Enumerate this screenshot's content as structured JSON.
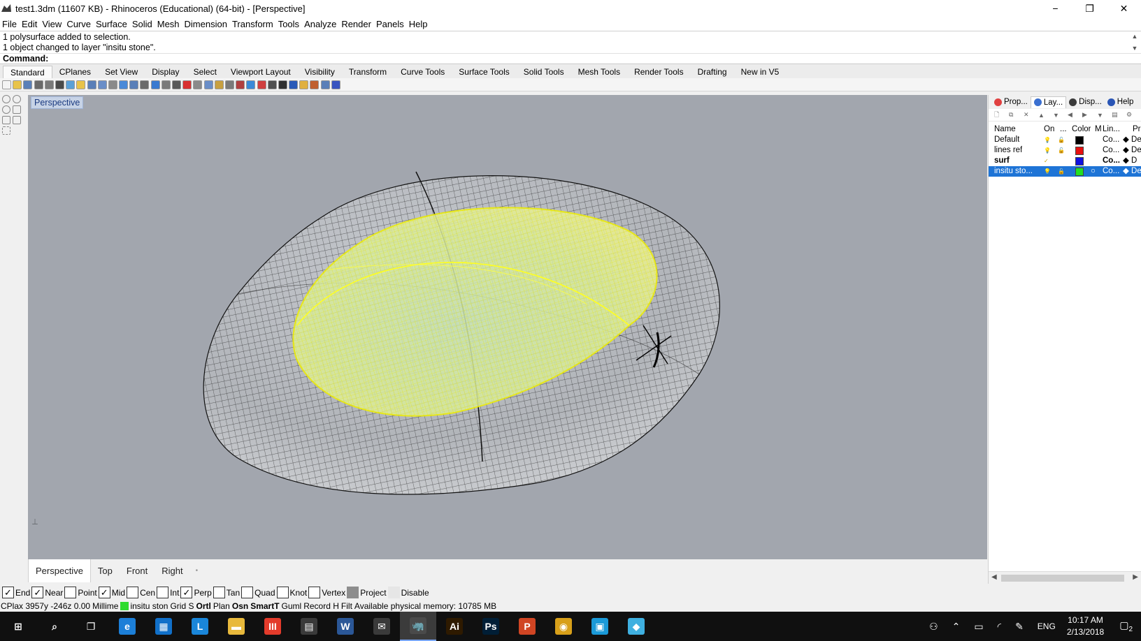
{
  "window": {
    "title": "test1.3dm (11607 KB) - Rhinoceros (Educational) (64-bit) - [Perspective]",
    "minimize": "−",
    "restore": "❐",
    "close": "✕"
  },
  "menu": [
    "File",
    "Edit",
    "View",
    "Curve",
    "Surface",
    "Solid",
    "Mesh",
    "Dimension",
    "Transform",
    "Tools",
    "Analyze",
    "Render",
    "Panels",
    "Help"
  ],
  "command": {
    "history": [
      "1 polysurface added to selection.",
      "1 object changed to layer \"insitu stone\"."
    ],
    "prompt": "Command:"
  },
  "toolbar_tabs": [
    "Standard",
    "CPlanes",
    "Set View",
    "Display",
    "Select",
    "Viewport Layout",
    "Visibility",
    "Transform",
    "Curve Tools",
    "Surface Tools",
    "Solid Tools",
    "Mesh Tools",
    "Render Tools",
    "Drafting",
    "New in V5"
  ],
  "toolbar_tabs_active": "Standard",
  "viewport": {
    "label": "Perspective",
    "tabs": [
      "Perspective",
      "Top",
      "Front",
      "Right"
    ],
    "active_tab": "Perspective",
    "background": "#a2a6ae"
  },
  "panel": {
    "tabs": [
      {
        "label": "Prop...",
        "icon": "properties-icon",
        "color": "#e04040"
      },
      {
        "label": "Lay...",
        "icon": "layers-icon",
        "color": "#3a6fd0"
      },
      {
        "label": "Disp...",
        "icon": "display-icon",
        "color": "#3a3a3a"
      },
      {
        "label": "Help",
        "icon": "help-icon",
        "color": "#2a55b5"
      }
    ],
    "active_tab": "Lay...",
    "columns": {
      "name": "Name",
      "on": "On",
      "lock": "...",
      "color": "Color",
      "material": "M",
      "linetype": "Lin...",
      "print": "Pr"
    },
    "layers": [
      {
        "name": "Default",
        "on": "💡",
        "lock": "🔓",
        "color": "#000000",
        "material": "",
        "linetype": "Co...",
        "print": "◆ De",
        "selected": false,
        "current": false
      },
      {
        "name": "lines ref",
        "on": "💡",
        "lock": "🔓",
        "color": "#e81010",
        "material": "",
        "linetype": "Co...",
        "print": "◆ De",
        "selected": false,
        "current": false
      },
      {
        "name": "surf",
        "on": "✓",
        "lock": "",
        "color": "#1010e0",
        "material": "",
        "linetype": "Co...",
        "print": "◆ D",
        "selected": false,
        "current": true
      },
      {
        "name": "insitu sto...",
        "on": "💡",
        "lock": "🔓",
        "color": "#21e021",
        "material": "○",
        "linetype": "Co...",
        "print": "◆ De",
        "selected": true,
        "current": false
      }
    ]
  },
  "osnaps": [
    {
      "label": "End",
      "checked": true
    },
    {
      "label": "Near",
      "checked": true
    },
    {
      "label": "Point",
      "checked": false
    },
    {
      "label": "Mid",
      "checked": true
    },
    {
      "label": "Cen",
      "checked": false
    },
    {
      "label": "Int",
      "checked": false
    },
    {
      "label": "Perp",
      "checked": true
    },
    {
      "label": "Tan",
      "checked": false
    },
    {
      "label": "Quad",
      "checked": false
    },
    {
      "label": "Knot",
      "checked": false
    },
    {
      "label": "Vertex",
      "checked": false
    },
    {
      "label": "Project",
      "checked": false,
      "style": "gray"
    },
    {
      "label": "Disable",
      "checked": false,
      "style": "light"
    }
  ],
  "status": {
    "cplane": "CPlax 3957y -246z 0.00",
    "units": "Millime",
    "layer": "insitu ston",
    "layer_color": "#2edb2e",
    "grid": "Grid S",
    "ortho": "Ortl",
    "planar": "Plan",
    "osnap": "Osn",
    "smarttrack": "SmartT",
    "gumball": "Guml",
    "record": "Record H",
    "filter": "Filt",
    "memory": "Available physical memory: 10785 MB"
  },
  "taskbar": {
    "apps": [
      {
        "name": "start-icon",
        "glyph": "⊞",
        "color": "#101010"
      },
      {
        "name": "search-icon",
        "glyph": "⌕",
        "color": "#101010"
      },
      {
        "name": "task-view-icon",
        "glyph": "❐",
        "color": "#101010"
      },
      {
        "name": "edge-icon",
        "glyph": "e",
        "color": "#1c7fd8"
      },
      {
        "name": "store-icon",
        "glyph": "▦",
        "color": "#1170c9"
      },
      {
        "name": "lumion-icon",
        "glyph": "L",
        "color": "#1a86d9"
      },
      {
        "name": "file-explorer-icon",
        "glyph": "▬",
        "color": "#e8b93c"
      },
      {
        "name": "app-red-icon",
        "glyph": "III",
        "color": "#e33b2b"
      },
      {
        "name": "calculator-icon",
        "glyph": "▤",
        "color": "#3a3a3a"
      },
      {
        "name": "word-icon",
        "glyph": "W",
        "color": "#2b5797"
      },
      {
        "name": "mail-icon",
        "glyph": "✉",
        "color": "#3a3a3a"
      },
      {
        "name": "rhino-icon",
        "glyph": "🦏",
        "color": "#4a4a4a"
      },
      {
        "name": "illustrator-icon",
        "glyph": "Ai",
        "color": "#2e1a00"
      },
      {
        "name": "photoshop-icon",
        "glyph": "Ps",
        "color": "#001e36"
      },
      {
        "name": "powerpoint-icon",
        "glyph": "P",
        "color": "#d04523"
      },
      {
        "name": "chrome-icon",
        "glyph": "◉",
        "color": "#d8a01a"
      },
      {
        "name": "app-frame-icon",
        "glyph": "▣",
        "color": "#1b9ad8"
      },
      {
        "name": "app-cube-icon",
        "glyph": "◆",
        "color": "#3fb0e0"
      }
    ],
    "active_app": "rhino-icon",
    "lang": "ENG",
    "time": "10:17 AM",
    "date": "2/13/2018",
    "notifications": "2"
  }
}
